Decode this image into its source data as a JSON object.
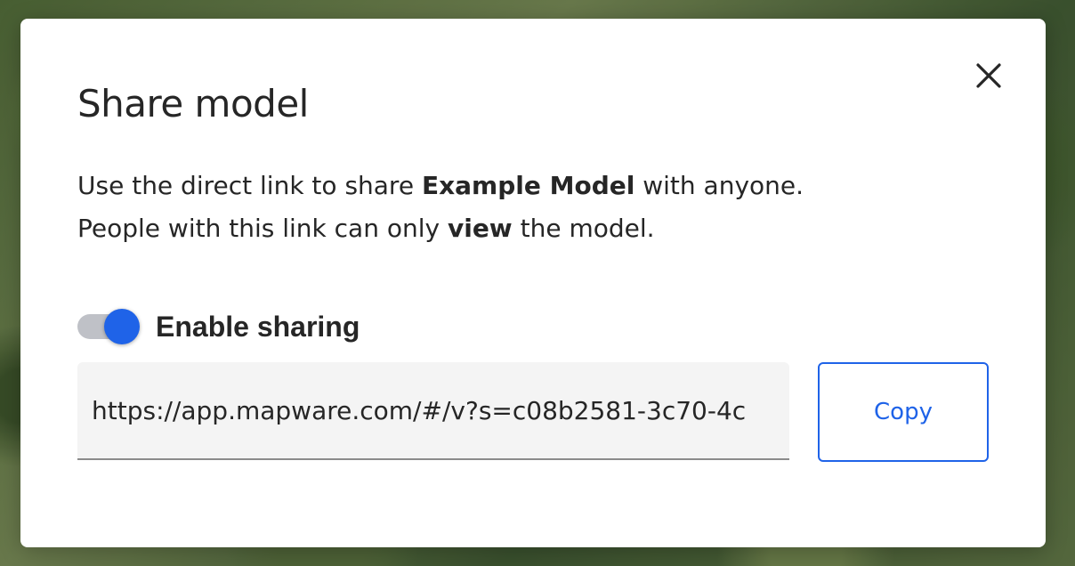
{
  "dialog": {
    "title": "Share model",
    "description": {
      "line1_prefix": "Use the direct link to share ",
      "model_name": "Example Model",
      "line1_suffix": " with anyone.",
      "line2_prefix": "People with this link can only ",
      "permission": "view",
      "line2_suffix": " the model."
    },
    "sharing": {
      "label": "Enable sharing",
      "enabled": true
    },
    "link": {
      "value": "https://app.mapware.com/#/v?s=c08b2581-3c70-4c"
    },
    "copy_label": "Copy",
    "close_icon": "close-icon"
  },
  "colors": {
    "accent": "#1f63e8",
    "text": "#262626",
    "toggle_track": "#bfc1c7",
    "field_bg": "#f4f4f4"
  }
}
